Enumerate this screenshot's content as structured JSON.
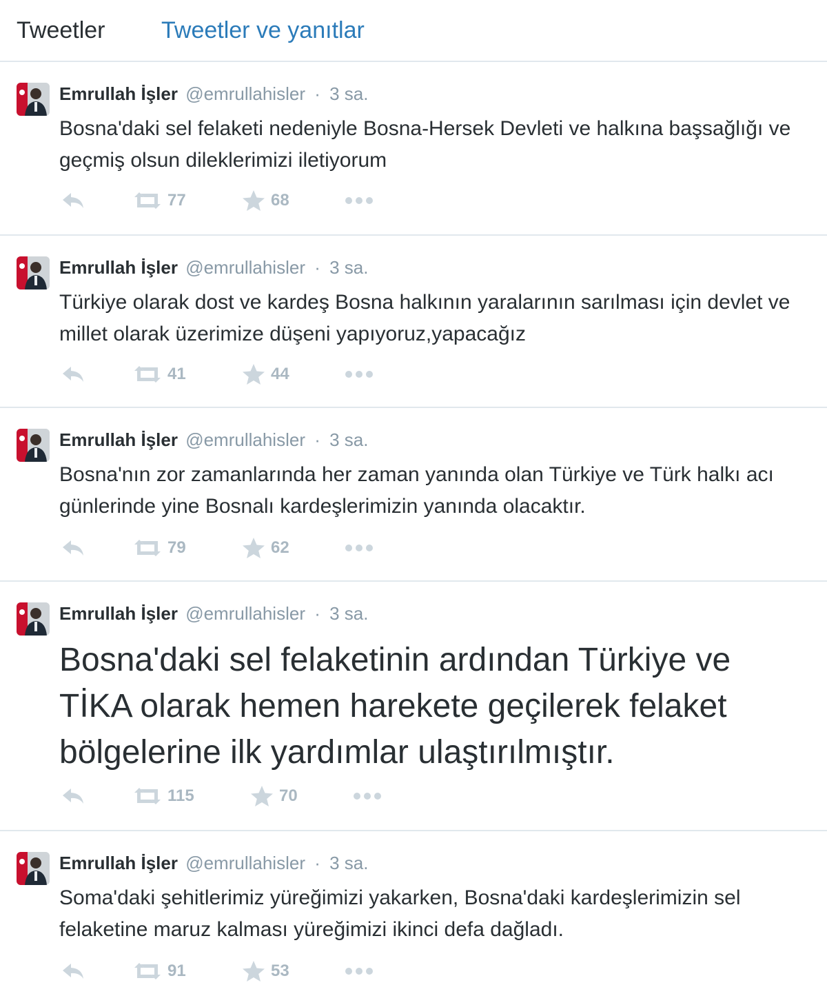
{
  "tabs": {
    "tweets": "Tweetler",
    "tweets_replies": "Tweetler ve yanıtlar"
  },
  "colors": {
    "accent": "#2b7bb9",
    "text": "#292f33",
    "muted": "#8899a6",
    "action_icon": "#ccd6dd",
    "action_count": "#aab8c2",
    "divider": "#e1e8ed"
  },
  "icons": {
    "reply": "reply-icon",
    "retweet": "retweet-icon",
    "favorite": "star-icon",
    "more": "more-dots-icon"
  },
  "tweets": [
    {
      "fullname": "Emrullah İşler",
      "username": "@emrullahisler",
      "separator": "·",
      "time": "3 sa.",
      "text": "Bosna'daki sel felaketi nedeniyle Bosna-Hersek Devleti ve halkına başsağlığı ve geçmiş olsun dileklerimizi iletiyorum",
      "retweets": "77",
      "favorites": "68"
    },
    {
      "fullname": "Emrullah İşler",
      "username": "@emrullahisler",
      "separator": "·",
      "time": "3 sa.",
      "text": "Türkiye olarak dost ve kardeş Bosna halkının yaralarının sarılması için devlet ve millet olarak üzerimize düşeni yapıyoruz,yapacağız",
      "retweets": "41",
      "favorites": "44"
    },
    {
      "fullname": "Emrullah İşler",
      "username": "@emrullahisler",
      "separator": "·",
      "time": "3 sa.",
      "text": "Bosna'nın zor zamanlarında her zaman yanında olan Türkiye ve Türk halkı acı günlerinde yine Bosnalı kardeşlerimizin yanında olacaktır.",
      "retweets": "79",
      "favorites": "62"
    },
    {
      "fullname": "Emrullah İşler",
      "username": "@emrullahisler",
      "separator": "·",
      "time": "3 sa.",
      "text": "Bosna'daki sel felaketinin ardından Türkiye ve TİKA olarak hemen harekete geçilerek felaket bölgelerine ilk yardımlar ulaştırılmıştır.",
      "retweets": "115",
      "favorites": "70"
    },
    {
      "fullname": "Emrullah İşler",
      "username": "@emrullahisler",
      "separator": "·",
      "time": "3 sa.",
      "text": "Soma'daki şehitlerimiz yüreğimizi yakarken, Bosna'daki kardeşlerimizin sel felaketine maruz kalması yüreğimizi ikinci defa dağladı.",
      "retweets": "91",
      "favorites": "53"
    }
  ]
}
